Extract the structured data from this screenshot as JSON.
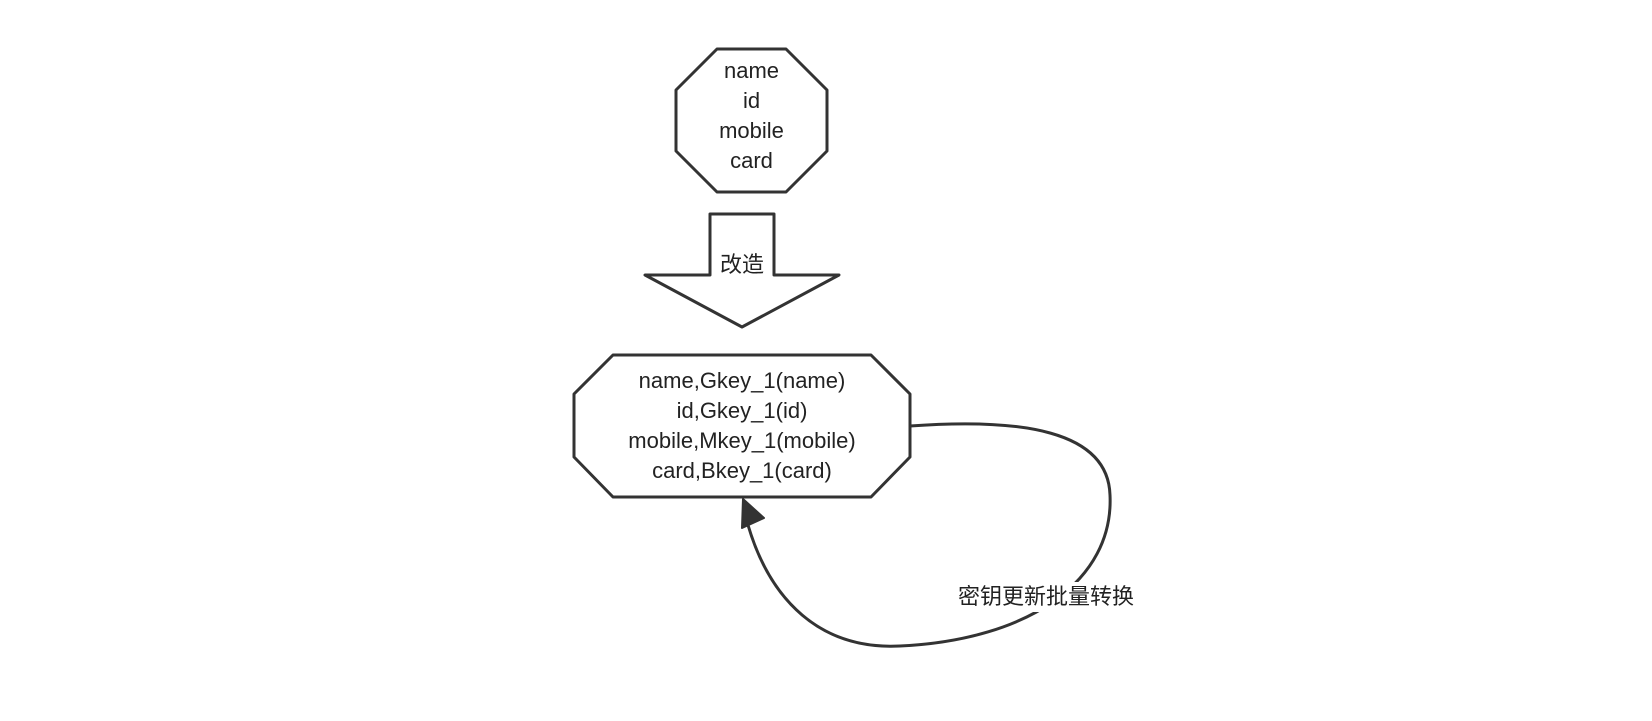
{
  "diagram": {
    "source_node": {
      "lines": [
        "name",
        "id",
        "mobile",
        "card"
      ]
    },
    "transform_arrow": {
      "label": "改造"
    },
    "result_node": {
      "lines": [
        "name,Gkey_1(name)",
        "id,Gkey_1(id)",
        "mobile,Mkey_1(mobile)",
        "card,Bkey_1(card)"
      ]
    },
    "loop_edge": {
      "label": "密钥更新批量转换"
    }
  },
  "colors": {
    "stroke": "#333333",
    "text": "#222222",
    "background": "#ffffff"
  }
}
